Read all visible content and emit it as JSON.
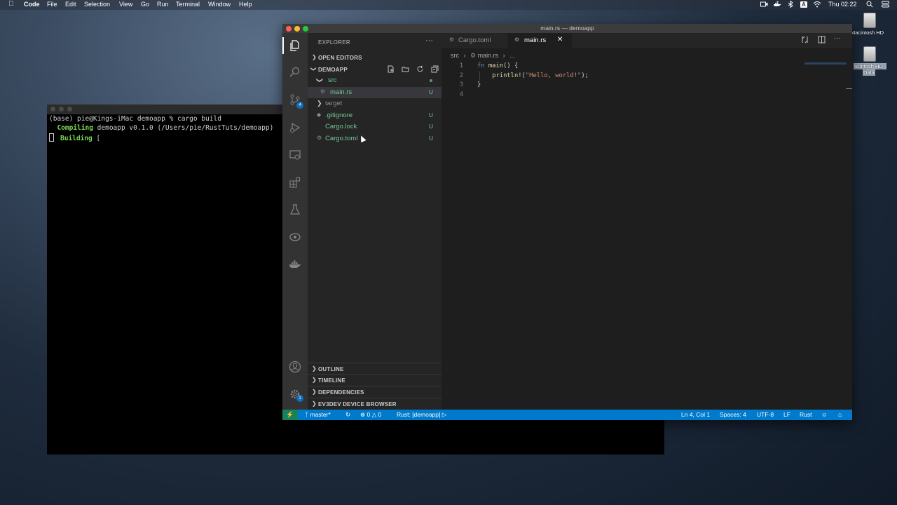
{
  "menubar": {
    "app_name": "Code",
    "items": [
      "File",
      "Edit",
      "Selection",
      "View",
      "Go",
      "Run",
      "Terminal",
      "Window",
      "Help"
    ],
    "clock": "Thu 02:22",
    "input_source": "A"
  },
  "desktop": {
    "disk1": "Macintosh HD",
    "disk2_line1": "acintosh HD -",
    "disk2_line2": "Data"
  },
  "terminal": {
    "line1": "(base) pie@Kings-iMac demoapp % cargo build",
    "line2_verb": "Compiling",
    "line2_rest": " demoapp v0.1.0 (/Users/pie/RustTuts/demoapp)",
    "line3_verb": "Building",
    "line3_rest": " ["
  },
  "vscode": {
    "window_title": "main.rs — demoapp",
    "sidebar": {
      "title": "EXPLORER",
      "more": "···",
      "open_editors": "OPEN EDITORS",
      "project": "DEMOAPP",
      "tree": [
        {
          "name": "src",
          "status": ""
        },
        {
          "name": "main.rs",
          "status": "U"
        },
        {
          "name": "target",
          "status": ""
        },
        {
          "name": ".gitignore",
          "status": "U"
        },
        {
          "name": "Cargo.lock",
          "status": "U"
        },
        {
          "name": "Cargo.toml",
          "status": "U"
        }
      ],
      "bottom_sections": [
        "OUTLINE",
        "TIMELINE",
        "DEPENDENCIES",
        "EV3DEV DEVICE BROWSER"
      ]
    },
    "activity_badges": {
      "scm": "4",
      "settings": "1"
    },
    "tabs": [
      {
        "label": "Cargo.toml"
      },
      {
        "label": "main.rs"
      }
    ],
    "breadcrumb": {
      "folder": "src",
      "file": "main.rs",
      "more": "..."
    },
    "code": {
      "line_numbers": [
        "1",
        "2",
        "3",
        "4"
      ],
      "l1_kw": "fn",
      "l1_fn": "main",
      "l1_rest": "() {",
      "l2_macro": "println!",
      "l2_open": "(",
      "l2_str": "\"Hello, world!\"",
      "l2_close": ");",
      "l3": "}"
    },
    "statusbar": {
      "remote": "⚡",
      "branch": "master*",
      "errors": "0",
      "warnings": "0",
      "rust": "Rust: [demoapp]",
      "position": "Ln 4, Col 1",
      "spaces": "Spaces: 4",
      "encoding": "UTF-8",
      "eol": "LF",
      "language": "Rust"
    },
    "colors": {
      "statusbar": "#007acc",
      "activitybar": "#333333",
      "sidebar": "#252526",
      "editor": "#1e1e1e",
      "git_untracked": "#73c991"
    }
  }
}
